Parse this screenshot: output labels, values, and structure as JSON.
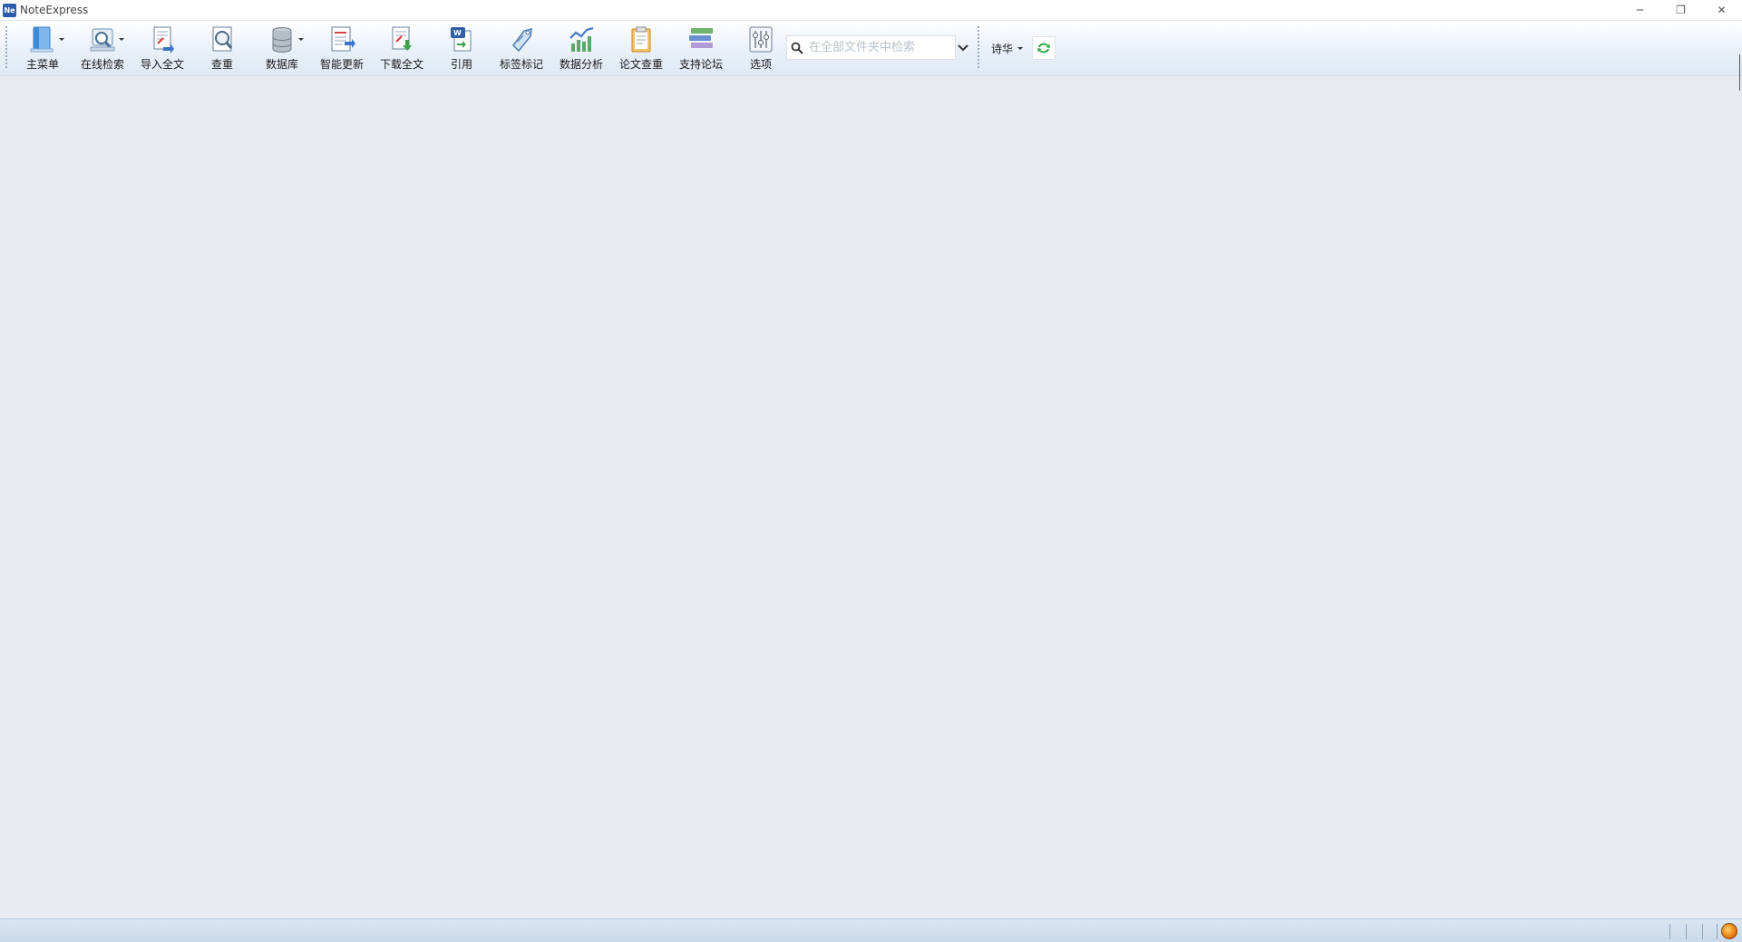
{
  "window": {
    "app_icon_text": "Ne",
    "title": "NoteExpress",
    "controls": {
      "minimize": "─",
      "restore": "❐",
      "close": "✕"
    }
  },
  "toolbar": {
    "buttons": [
      {
        "label": "主菜单",
        "icon": "main-menu-icon",
        "dropdown": true
      },
      {
        "label": "在线检索",
        "icon": "online-search-icon",
        "dropdown": true
      },
      {
        "label": "导入全文",
        "icon": "import-fulltext-icon",
        "dropdown": false
      },
      {
        "label": "查重",
        "icon": "duplicate-check-icon",
        "dropdown": false
      },
      {
        "label": "数据库",
        "icon": "database-icon",
        "dropdown": true
      },
      {
        "label": "智能更新",
        "icon": "smart-update-icon",
        "dropdown": false
      },
      {
        "label": "下载全文",
        "icon": "download-fulltext-icon",
        "dropdown": false
      },
      {
        "label": "引用",
        "icon": "cite-icon",
        "dropdown": false
      },
      {
        "label": "标签标记",
        "icon": "tag-icon",
        "dropdown": false
      },
      {
        "label": "数据分析",
        "icon": "data-analysis-icon",
        "dropdown": false
      },
      {
        "label": "论文查重",
        "icon": "paper-check-icon",
        "dropdown": false
      },
      {
        "label": "支持论坛",
        "icon": "forum-icon",
        "dropdown": false
      },
      {
        "label": "选项",
        "icon": "options-icon",
        "dropdown": false
      }
    ],
    "search": {
      "placeholder": "在全部文件夹中检索",
      "value": ""
    },
    "user": {
      "name": "诗华"
    }
  },
  "colors": {
    "background": "#e8ecf0",
    "toolbar_top": "#ffffff",
    "toolbar_bottom": "#dfe8f4",
    "accent_blue": "#2b5fae",
    "sync_green": "#2aa33a"
  }
}
